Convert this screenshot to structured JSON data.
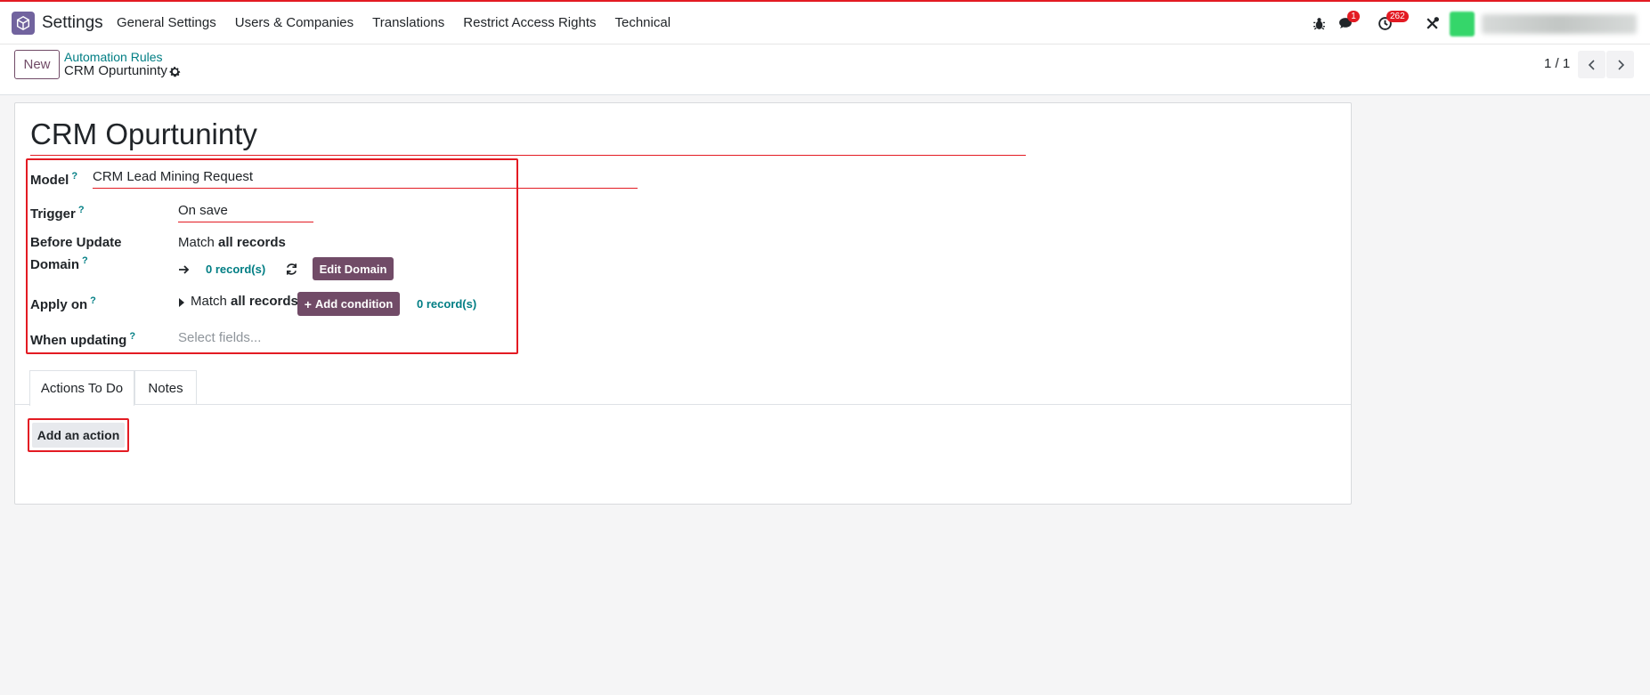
{
  "app": {
    "name": "Settings"
  },
  "menu": [
    "General Settings",
    "Users & Companies",
    "Translations",
    "Restrict Access Rights",
    "Technical"
  ],
  "systray": {
    "messages_badge": "1",
    "activities_badge": "262"
  },
  "control": {
    "new_label": "New",
    "breadcrumb_parent": "Automation Rules",
    "breadcrumb_current": "CRM Opurtuninty",
    "pager": "1 / 1"
  },
  "record": {
    "title": "CRM Opurtuninty",
    "model_label": "Model",
    "model_value": "CRM Lead Mining Request",
    "trigger_label": "Trigger",
    "trigger_value": "On save",
    "before_label_1": "Before Update",
    "before_label_2": "Domain",
    "before_match": "Match",
    "before_match_bold": "all records",
    "before_count": "0 record(s)",
    "edit_domain": "Edit Domain",
    "apply_label": "Apply on",
    "apply_match": "Match",
    "apply_match_bold": "all records",
    "add_condition": "Add condition",
    "apply_count": "0 record(s)",
    "when_label": "When updating",
    "when_placeholder": "Select fields...",
    "help_mark": "?"
  },
  "tabs": [
    "Actions To Do",
    "Notes"
  ],
  "actions": {
    "add_label": "Add an action"
  },
  "icons": {
    "app_logo": "settings-box-icon",
    "debug": "bug-icon",
    "messages": "chat-icon",
    "activities": "clock-icon",
    "tools": "wrench-screwdriver-icon",
    "gear": "gear-icon",
    "pager_prev": "chevron-left-icon",
    "pager_next": "chevron-right-icon",
    "arrow": "arrow-right-icon",
    "refresh": "refresh-icon",
    "caret": "caret-right-icon",
    "plus": "plus-icon"
  },
  "colors": {
    "brand": "#714b67",
    "teal": "#017e84",
    "highlight": "#e31b23",
    "badge": "#e31b23"
  }
}
